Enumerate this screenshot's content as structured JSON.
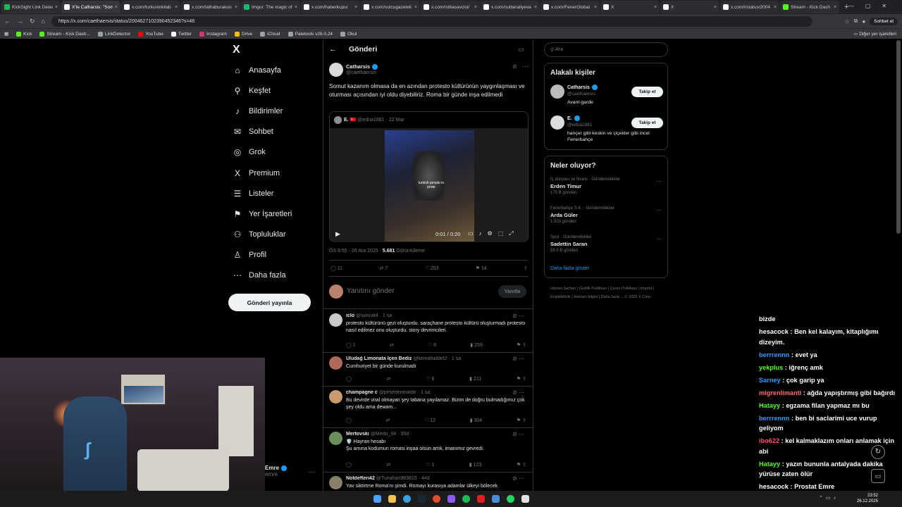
{
  "browser": {
    "tabs": [
      {
        "title": "KickSight Link Detec",
        "color": "#1db954",
        "active": false
      },
      {
        "title": "X'te Catharsis: \"Som",
        "color": "#ffffff",
        "active": true
      },
      {
        "title": "x.com/turkuninkilab",
        "color": "#ffffff",
        "active": false
      },
      {
        "title": "x.com/talhaburakun",
        "color": "#ffffff",
        "active": false
      },
      {
        "title": "Imgur: The magic of",
        "color": "#1bb76e",
        "active": false
      },
      {
        "title": "x.com/haberkupu/",
        "color": "#ffffff",
        "active": false
      },
      {
        "title": "x.com/solcugazeteli",
        "color": "#ffffff",
        "active": false
      },
      {
        "title": "x.com/istbasavcisi/",
        "color": "#ffffff",
        "active": false
      },
      {
        "title": "x.com/sultanaliyeva",
        "color": "#ffffff",
        "active": false
      },
      {
        "title": "x.com/FenerGlobal",
        "color": "#ffffff",
        "active": false
      },
      {
        "title": "X",
        "color": "#ffffff",
        "active": false
      },
      {
        "title": "X",
        "color": "#ffffff",
        "active": false
      },
      {
        "title": "x.com/i/status/2004",
        "color": "#ffffff",
        "active": false
      },
      {
        "title": "Stream - Kick Dash",
        "color": "#53fc18",
        "active": false
      }
    ],
    "url": "https://x.com/caethaersis/status/2004627102390452346?s=46",
    "profile_label": "Sohbet et",
    "bookmarks": [
      {
        "label": "Kick",
        "color": "#53fc18"
      },
      {
        "label": "Stream - Kick Dash...",
        "color": "#53fc18"
      },
      {
        "label": "LinkDetector",
        "color": "#9aa0a6"
      },
      {
        "label": "YouTube",
        "color": "#ff0000"
      },
      {
        "label": "Twitter",
        "color": "#ffffff"
      },
      {
        "label": "Instagram",
        "color": "#e1306c"
      },
      {
        "label": "Drive",
        "color": "#fbbc04"
      },
      {
        "label": "iCloud",
        "color": "#9aa0a6"
      },
      {
        "label": "Paletools v26.0.24",
        "color": "#9aa0a6"
      },
      {
        "label": "Okul",
        "color": "#9aa0a6"
      }
    ],
    "other_bookmarks": "Diğer yer işaretleri"
  },
  "nav": {
    "logo": "X",
    "items": [
      {
        "label": "Anasayfa",
        "icon": "⌂"
      },
      {
        "label": "Keşfet",
        "icon": "⚲"
      },
      {
        "label": "Bildirimler",
        "icon": "♪"
      },
      {
        "label": "Sohbet",
        "icon": "✉"
      },
      {
        "label": "Grok",
        "icon": "◎"
      },
      {
        "label": "Premium",
        "icon": "X"
      },
      {
        "label": "Listeler",
        "icon": "☰"
      },
      {
        "label": "Yer İşaretleri",
        "icon": "⚑"
      },
      {
        "label": "Topluluklar",
        "icon": "⚇"
      },
      {
        "label": "Profil",
        "icon": "♙"
      },
      {
        "label": "Daha fazla",
        "icon": "⋯"
      }
    ],
    "post_button": "Gönderi yayınla",
    "account_name": "Emre",
    "account_handle": "emre"
  },
  "post": {
    "header": "Gönderi",
    "author": "Catharsis",
    "handle": "@caethaersis",
    "text": "Somut kazanım olmasa da en azından protesto kültürünün yaygınlaşması ve oturması açısından iyi oldu diyebiliriz. Roma bir günde inşa edilmedi",
    "quote": {
      "author": "E.",
      "handle": "@edna1881",
      "date": "22 Mar",
      "video_caption": "turkish people in prote",
      "video_time": "0:01 / 0:20"
    },
    "meta_time": "ÖS 9:55 · 26 Ara 2025 ·",
    "views": "5.681",
    "views_label": "Görüntüleme",
    "stats": {
      "replies": "11",
      "reposts": "7",
      "likes": "253",
      "bookmarks": "14"
    },
    "reply_placeholder": "Yanıtını gönder",
    "reply_button": "Yanıtla"
  },
  "replies": [
    {
      "name": "iclo",
      "handle": "@suncat4 · 1 sa",
      "text": "protesto kültürünü gezi oluşturdu. saraçhane protesto kültürü oluşturmadı protesto nasıl edilmez onu oluşturdu. story devrimcileri.",
      "stats": [
        "1",
        "",
        "8",
        "259"
      ],
      "color": "#c9c9c9"
    },
    {
      "name": "Uludağ Limonata İçen Bediz",
      "handle": "@kemalsiddet2 · 1 sa",
      "text": "Cumhuriyet bir günde kurulmadı",
      "stats": [
        "",
        "",
        "6",
        "211"
      ],
      "color": "#b06a5a"
    },
    {
      "name": "champagne c",
      "handle": "@pesedenmaldir · 1 sa",
      "text": "Bu devirde viral olmayan şey tabana yayılamaz. Bizim de doğru bulmadığımız çok şey oldu ama dewam...",
      "stats": [
        "",
        "",
        "12",
        "304"
      ],
      "color": "#c99a6e"
    },
    {
      "name": "Mertovski",
      "handle": "@Merto_04 · 35d",
      "text": "🛡️ Hayran hesabı\nŞu amına kodumun romasi inşaa olsun artık, imanımız gevredi.",
      "stats": [
        "",
        "",
        "1",
        "123"
      ],
      "color": "#6a8f5a"
    },
    {
      "name": "Notdefteri42",
      "handle": "@Tunahan983815 · 44d",
      "text": "Yav siktirtme Roma'nı şimdi. Romayı kurasıya adamlar ülkeyi bölecek",
      "stats": [
        "",
        "",
        "",
        ""
      ],
      "color": "#8a7f6a"
    }
  ],
  "right": {
    "search_placeholder": "Ara",
    "relevant_title": "Alakalı kişiler",
    "people": [
      {
        "name": "Catharsis",
        "handle": "@caethaersis",
        "bio": "Avant-garde",
        "button": "Takip et"
      },
      {
        "name": "E.",
        "handle": "@edna1881",
        "bio": "hançer gibi keskin ve çiçekler gibi incel Fenerbahçe",
        "button": "Takip et"
      }
    ],
    "trends_title": "Neler oluyor?",
    "trends": [
      {
        "category": "İş dünyası ve finans · Gündemdekiler",
        "name": "Erden Timur",
        "count": "170 B gönderi"
      },
      {
        "category": "Fenerbahçe S.K. · Gündemdekiler",
        "name": "Arda Güler",
        "count": "1.503 gönderi"
      },
      {
        "category": "Spor · Gündemdekiler",
        "name": "Sadettin Saran",
        "count": "58,9 B gönderi"
      }
    ],
    "show_more": "Daha fazla göster",
    "footer": "Hizmet Şartları | Gizlilik Politikası | Çerez Politikası | Imprint | Erişilebilirlik | Reklam bilgisi | Daha fazla ... © 2025 X Corp."
  },
  "chat": [
    {
      "user": "",
      "msg": "bizde",
      "color": "#ffffff"
    },
    {
      "user": "hesacock",
      "msg": "Ben kel kalayım, kitaplığımı dizeyim.",
      "color": "#ffffff"
    },
    {
      "user": "berrrennn",
      "msg": "evet ya",
      "color": "#2e9bff"
    },
    {
      "user": "yekplus",
      "msg": "iğrenç amk",
      "color": "#53fc18"
    },
    {
      "user": "Sarney",
      "msg": "çok garip ya",
      "color": "#2e9bff"
    },
    {
      "user": "migrenlimanti",
      "msg": "ağda yapıştırmış gibi bağırdı",
      "color": "#ff6b6b"
    },
    {
      "user": "Hatayy",
      "msg": "egzama filan yapmaz mı bu",
      "color": "#53fc18"
    },
    {
      "user": "berrrennn",
      "msg": "ben bi saclarimi uce vurup geliyom",
      "color": "#2e9bff"
    },
    {
      "user": "ibo622",
      "msg": "kel kalmaklazım onları anlamak için abi",
      "color": "#ff4d6d"
    },
    {
      "user": "Hatayy",
      "msg": "yazın bununla antalyada dakika yürüse zaten ölür",
      "color": "#53fc18"
    },
    {
      "user": "hesacock",
      "msg": "Prostat Emre",
      "color": "#ffffff"
    }
  ],
  "taskbar": {
    "time": "23:52",
    "date": "26.12.2025"
  }
}
